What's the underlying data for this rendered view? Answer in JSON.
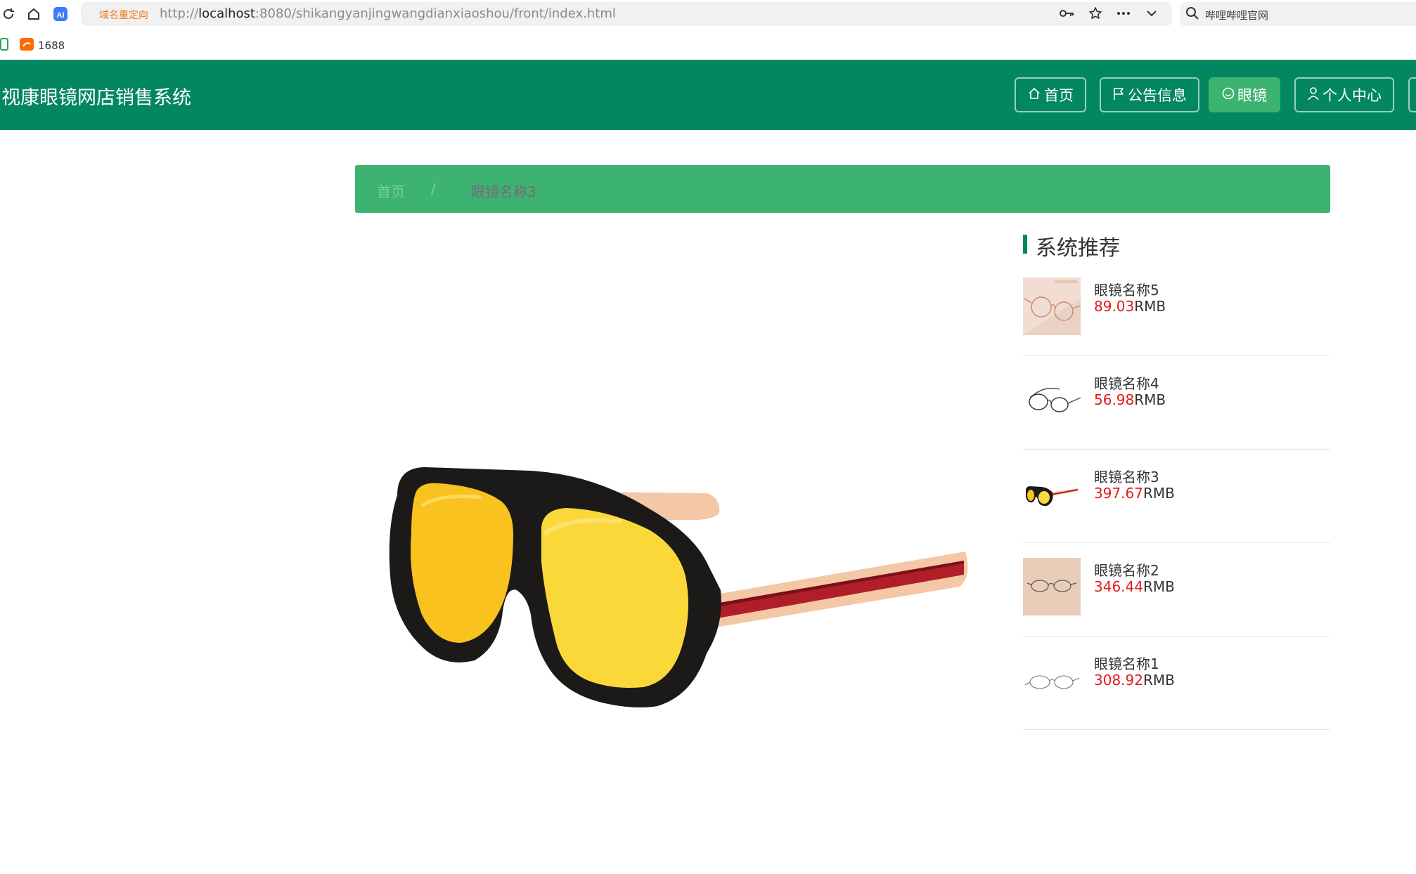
{
  "browser": {
    "redirect_tag": "域名重定向",
    "url_prefix": "http://",
    "url_host": "localhost",
    "url_rest": ":8080/shikangyanjingwangdianxiaoshou/front/index.html",
    "search_text": "哔哩哔哩官网",
    "bookmark_label": "1688"
  },
  "header": {
    "site_title": "视康眼镜网店销售系统",
    "nav": [
      {
        "label": "首页",
        "icon": "home-icon"
      },
      {
        "label": "公告信息",
        "icon": "flag-icon"
      },
      {
        "label": "眼镜",
        "icon": "smile-icon"
      },
      {
        "label": "个人中心",
        "icon": "user-icon"
      }
    ],
    "active_index": 2
  },
  "breadcrumb": {
    "home": "首页",
    "separator": "/",
    "current": "眼镜名称3"
  },
  "recommend": {
    "title": "系统推荐",
    "unit": "RMB",
    "items": [
      {
        "name": "眼镜名称5",
        "price": "89.03"
      },
      {
        "name": "眼镜名称4",
        "price": "56.98"
      },
      {
        "name": "眼镜名称3",
        "price": "397.67"
      },
      {
        "name": "眼镜名称2",
        "price": "346.44"
      },
      {
        "name": "眼镜名称1",
        "price": "308.92"
      }
    ]
  },
  "colors": {
    "header_bg": "#028760",
    "accent": "#3cb371",
    "price": "#e41b1b"
  }
}
